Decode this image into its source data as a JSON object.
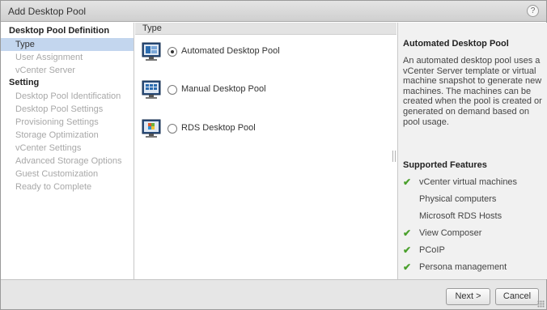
{
  "dialog": {
    "title": "Add Desktop Pool",
    "help_icon": "help-icon",
    "help_glyph": "?"
  },
  "nav": {
    "section1": "Desktop Pool Definition",
    "section1_steps": [
      {
        "label": "Type",
        "active": true
      },
      {
        "label": "User Assignment",
        "active": false
      },
      {
        "label": "vCenter Server",
        "active": false
      }
    ],
    "section2": "Setting",
    "section2_steps": [
      {
        "label": "Desktop Pool Identification"
      },
      {
        "label": "Desktop Pool Settings"
      },
      {
        "label": "Provisioning Settings"
      },
      {
        "label": "Storage Optimization"
      },
      {
        "label": "vCenter Settings"
      },
      {
        "label": "Advanced Storage Options"
      },
      {
        "label": "Guest Customization"
      },
      {
        "label": "Ready to Complete"
      }
    ]
  },
  "main": {
    "header": "Type",
    "options": [
      {
        "label": "Automated Desktop Pool",
        "selected": true,
        "icon": "automated-pool-icon"
      },
      {
        "label": "Manual Desktop Pool",
        "selected": false,
        "icon": "manual-pool-icon"
      },
      {
        "label": "RDS Desktop Pool",
        "selected": false,
        "icon": "rds-pool-icon"
      }
    ]
  },
  "info": {
    "title": "Automated Desktop Pool",
    "description": "An automated desktop pool uses a vCenter Server template or virtual machine snapshot to generate new machines. The machines can be created when the pool is created or generated on demand based on pool usage.",
    "features_title": "Supported Features",
    "features": [
      {
        "label": "vCenter virtual machines",
        "supported": true
      },
      {
        "label": "Physical computers",
        "supported": false
      },
      {
        "label": "Microsoft RDS Hosts",
        "supported": false
      },
      {
        "label": "View Composer",
        "supported": true
      },
      {
        "label": "PCoIP",
        "supported": true
      },
      {
        "label": "Persona management",
        "supported": true
      }
    ],
    "check_glyph": "✔"
  },
  "footer": {
    "next_label": "Next >",
    "cancel_label": "Cancel"
  },
  "colors": {
    "active_step_bg": "#c3d6ee",
    "check_green": "#4aa02c",
    "disabled_text": "#a8a8a8"
  }
}
